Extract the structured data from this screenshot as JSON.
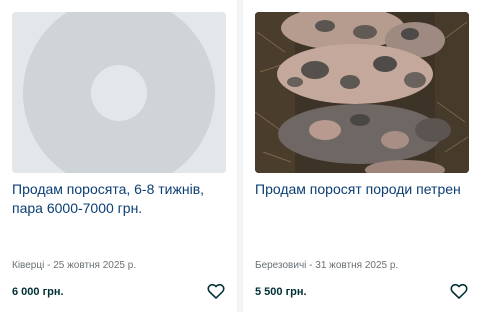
{
  "listings": [
    {
      "title": "Продам поросята, 6-8 тижнів, пара 6000-7000 грн.",
      "meta": "Ківерці - 25 жовтня 2025 р.",
      "price": "6 000 грн.",
      "image": "placeholder-image",
      "favorite_icon": "heart-icon"
    },
    {
      "title": "Продам поросят породи петрен",
      "meta": "Березовичі - 31 жовтня 2025 р.",
      "price": "5 500 грн.",
      "image": "photo-pigs",
      "favorite_icon": "heart-icon"
    }
  ],
  "colors": {
    "title": "#0b3e74",
    "price": "#002f34",
    "meta": "#6a7176",
    "background": "#f2f4f5"
  }
}
